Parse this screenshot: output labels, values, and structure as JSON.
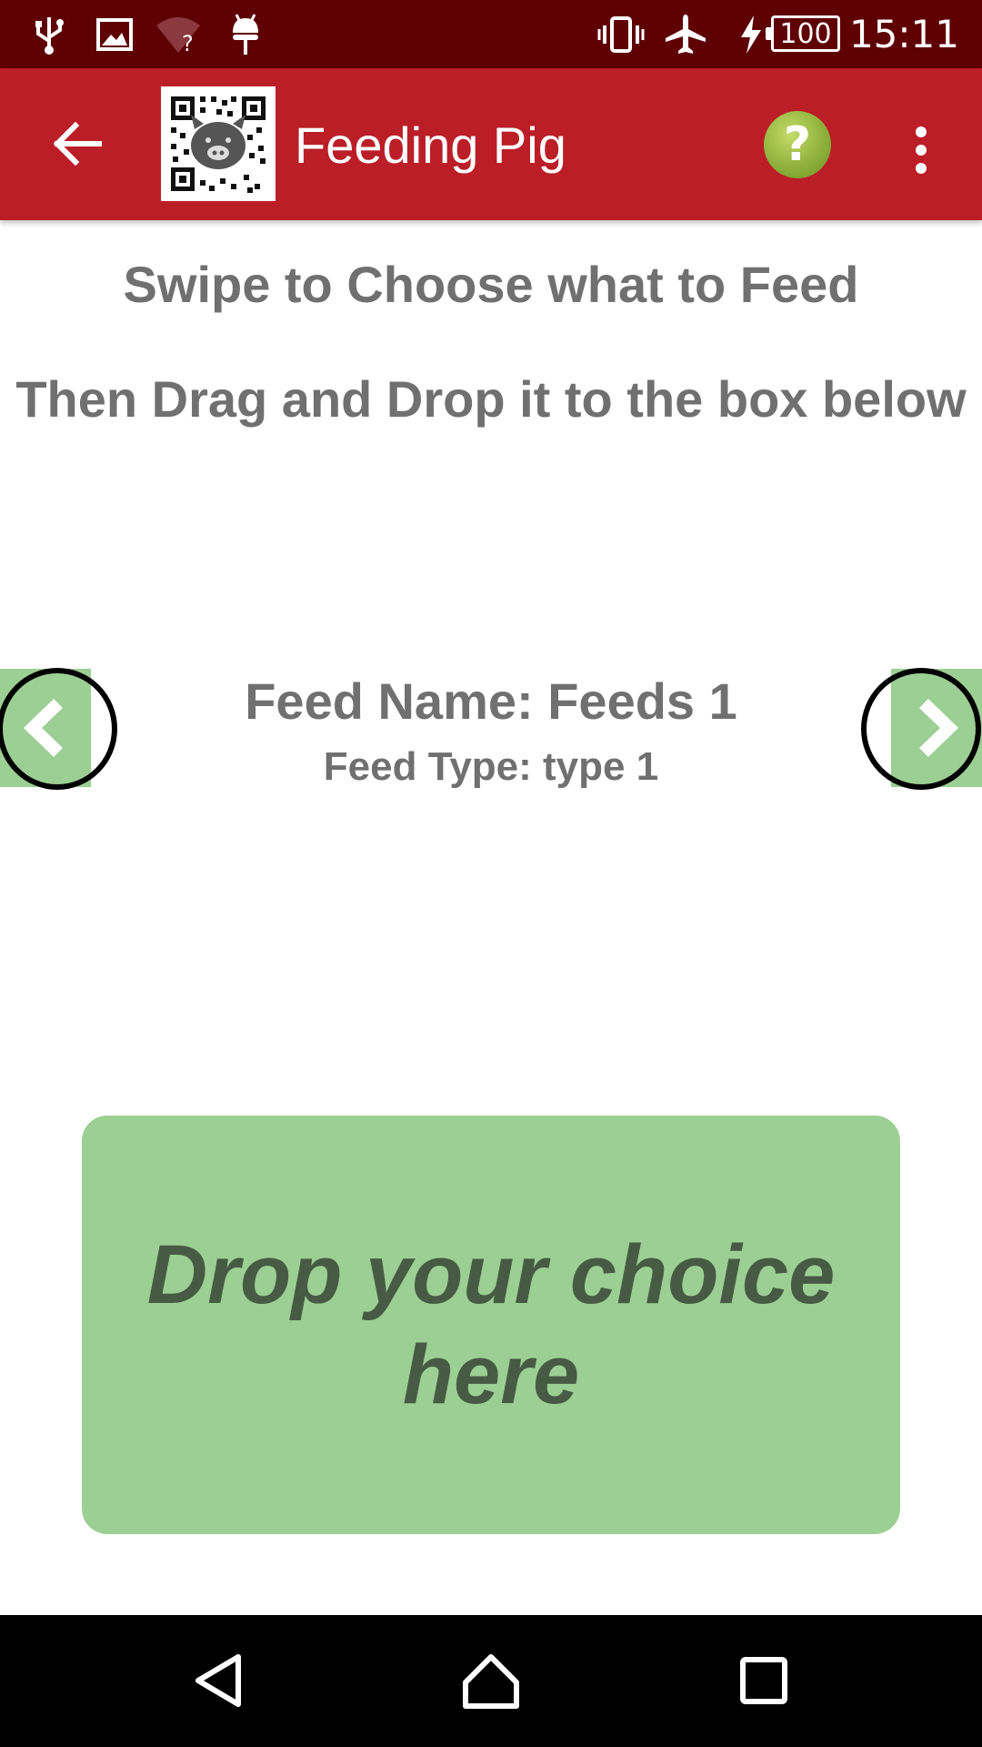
{
  "status_bar": {
    "icons": [
      "usb-icon",
      "image-icon",
      "wifi-unknown-icon",
      "android-debug-icon",
      "vibrate-icon",
      "airplane-mode-icon",
      "charging-icon"
    ],
    "battery_level": "100",
    "time": "15:11"
  },
  "app_bar": {
    "title": "Feeding Pig",
    "back_icon": "arrow-back-icon",
    "logo": "qr-pig-logo",
    "help_icon": "help-icon",
    "help_label": "?",
    "overflow_icon": "more-vert-icon"
  },
  "instructions": {
    "line1": "Swipe to Choose what to Feed",
    "line2": "Then Drag and Drop it to the box below"
  },
  "feed": {
    "name": "Feed Name: Feeds 1",
    "type": "Feed Type: type 1"
  },
  "drop_zone": {
    "text": "Drop your choice here"
  },
  "colors": {
    "status_bar": "#5e0004",
    "app_bar": "#bb1e27",
    "accent_green": "#9ccf93",
    "drop_text": "#475b44",
    "body_text": "#707070"
  },
  "nav_bar": {
    "icons": [
      "back-triangle-icon",
      "home-icon",
      "recents-icon"
    ]
  }
}
